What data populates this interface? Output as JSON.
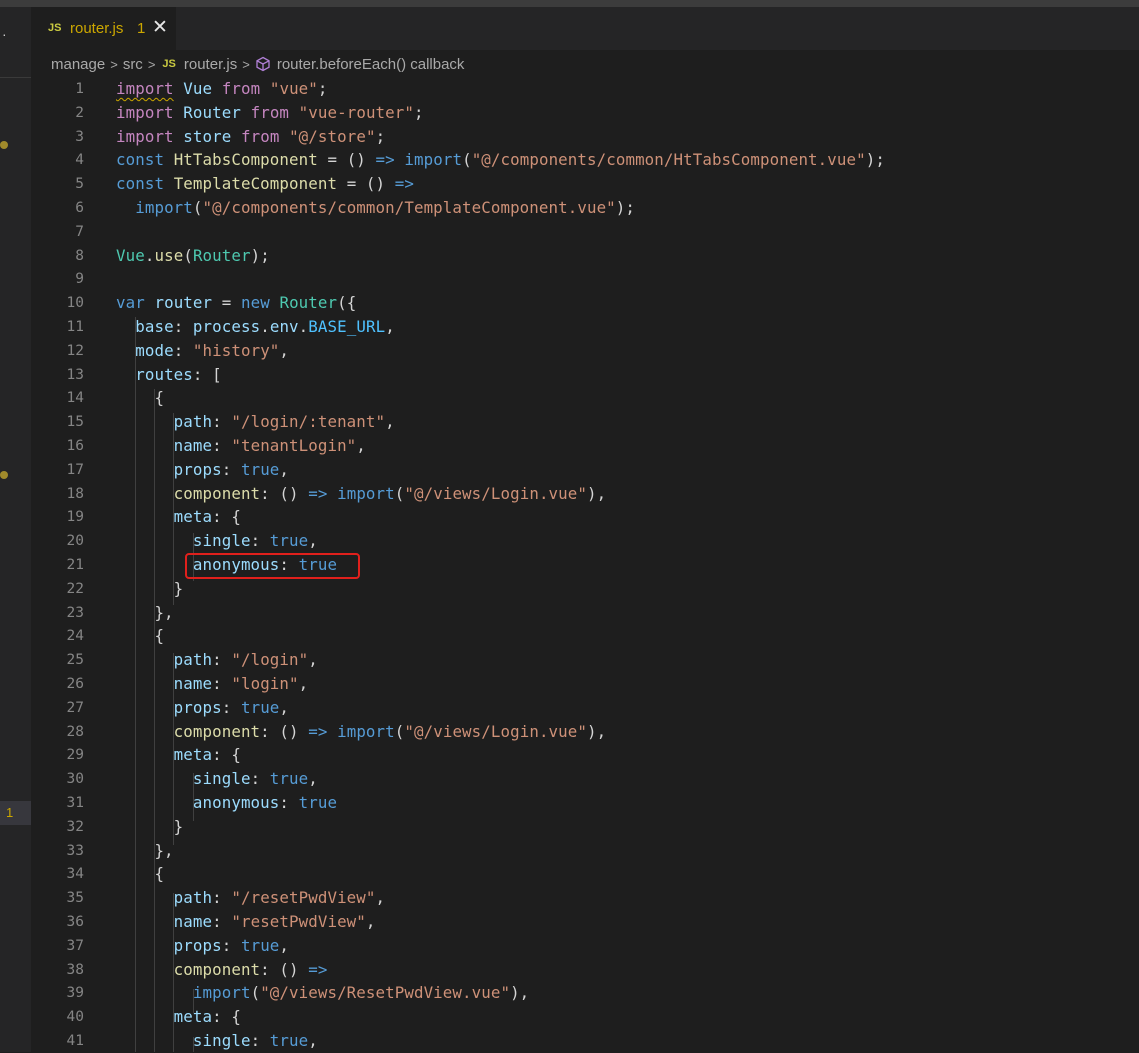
{
  "tab": {
    "js_badge": "JS",
    "filename": "router.js",
    "problem_count": "1",
    "close_glyph": "✕"
  },
  "breadcrumb": {
    "items": [
      "manage",
      "src",
      "router.js",
      "router.beforeEach() callback"
    ],
    "js_badge": "JS"
  },
  "sidebar": {
    "active_count": "1"
  },
  "lines": [
    {
      "n": "1",
      "t": [
        [
          "import",
          "kw2 squig"
        ],
        [
          " ",
          ""
        ],
        [
          "Vue",
          "var"
        ],
        [
          " ",
          ""
        ],
        [
          "from",
          "kw2"
        ],
        [
          " ",
          ""
        ],
        [
          "\"vue\"",
          "str"
        ],
        [
          ";",
          ""
        ]
      ]
    },
    {
      "n": "2",
      "t": [
        [
          "import",
          "kw2"
        ],
        [
          " ",
          ""
        ],
        [
          "Router",
          "var"
        ],
        [
          " ",
          ""
        ],
        [
          "from",
          "kw2"
        ],
        [
          " ",
          ""
        ],
        [
          "\"vue-router\"",
          "str"
        ],
        [
          ";",
          ""
        ]
      ]
    },
    {
      "n": "3",
      "t": [
        [
          "import",
          "kw2"
        ],
        [
          " ",
          ""
        ],
        [
          "store",
          "var"
        ],
        [
          " ",
          ""
        ],
        [
          "from",
          "kw2"
        ],
        [
          " ",
          ""
        ],
        [
          "\"@/store\"",
          "str"
        ],
        [
          ";",
          ""
        ]
      ]
    },
    {
      "n": "4",
      "t": [
        [
          "const",
          "kw"
        ],
        [
          " ",
          ""
        ],
        [
          "HtTabsComponent",
          "fn"
        ],
        [
          " = () ",
          ""
        ],
        [
          "=>",
          "kw"
        ],
        [
          " ",
          ""
        ],
        [
          "import",
          "kw"
        ],
        [
          "(",
          ""
        ],
        [
          "\"@/components/common/HtTabsComponent.vue\"",
          "str"
        ],
        [
          ");",
          ""
        ]
      ]
    },
    {
      "n": "5",
      "t": [
        [
          "const",
          "kw"
        ],
        [
          " ",
          ""
        ],
        [
          "TemplateComponent",
          "fn"
        ],
        [
          " = () ",
          ""
        ],
        [
          "=>",
          "kw"
        ]
      ]
    },
    {
      "n": "6",
      "t": [
        [
          "  ",
          ""
        ],
        [
          "import",
          "kw"
        ],
        [
          "(",
          ""
        ],
        [
          "\"@/components/common/TemplateComponent.vue\"",
          "str"
        ],
        [
          ");",
          ""
        ]
      ]
    },
    {
      "n": "7",
      "t": []
    },
    {
      "n": "8",
      "t": [
        [
          "Vue",
          "cls"
        ],
        [
          ".",
          ""
        ],
        [
          "use",
          "fn"
        ],
        [
          "(",
          ""
        ],
        [
          "Router",
          "cls"
        ],
        [
          ");",
          ""
        ]
      ]
    },
    {
      "n": "9",
      "t": []
    },
    {
      "n": "10",
      "t": [
        [
          "var",
          "kw"
        ],
        [
          " ",
          ""
        ],
        [
          "router",
          "var"
        ],
        [
          " = ",
          ""
        ],
        [
          "new",
          "kw"
        ],
        [
          " ",
          ""
        ],
        [
          "Router",
          "cls"
        ],
        [
          "({",
          ""
        ]
      ]
    },
    {
      "n": "11",
      "t": [
        [
          "  ",
          ""
        ],
        [
          "base",
          "var"
        ],
        [
          ": ",
          ""
        ],
        [
          "process",
          "var"
        ],
        [
          ".",
          ""
        ],
        [
          "env",
          "var"
        ],
        [
          ".",
          ""
        ],
        [
          "BASE_URL",
          "cst"
        ],
        [
          ",",
          ""
        ]
      ]
    },
    {
      "n": "12",
      "t": [
        [
          "  ",
          ""
        ],
        [
          "mode",
          "var"
        ],
        [
          ": ",
          ""
        ],
        [
          "\"history\"",
          "str"
        ],
        [
          ",",
          ""
        ]
      ]
    },
    {
      "n": "13",
      "t": [
        [
          "  ",
          ""
        ],
        [
          "routes",
          "var"
        ],
        [
          ": [",
          ""
        ]
      ]
    },
    {
      "n": "14",
      "t": [
        [
          "    {",
          ""
        ]
      ]
    },
    {
      "n": "15",
      "t": [
        [
          "      ",
          ""
        ],
        [
          "path",
          "var"
        ],
        [
          ": ",
          ""
        ],
        [
          "\"/login/:tenant\"",
          "str"
        ],
        [
          ",",
          ""
        ]
      ]
    },
    {
      "n": "16",
      "t": [
        [
          "      ",
          ""
        ],
        [
          "name",
          "var"
        ],
        [
          ": ",
          ""
        ],
        [
          "\"tenantLogin\"",
          "str"
        ],
        [
          ",",
          ""
        ]
      ]
    },
    {
      "n": "17",
      "t": [
        [
          "      ",
          ""
        ],
        [
          "props",
          "var"
        ],
        [
          ": ",
          ""
        ],
        [
          "true",
          "kw"
        ],
        [
          ",",
          ""
        ]
      ]
    },
    {
      "n": "18",
      "t": [
        [
          "      ",
          ""
        ],
        [
          "component",
          "fn"
        ],
        [
          ": () ",
          ""
        ],
        [
          "=>",
          "kw"
        ],
        [
          " ",
          ""
        ],
        [
          "import",
          "kw"
        ],
        [
          "(",
          ""
        ],
        [
          "\"@/views/Login.vue\"",
          "str"
        ],
        [
          "),",
          ""
        ]
      ]
    },
    {
      "n": "19",
      "t": [
        [
          "      ",
          ""
        ],
        [
          "meta",
          "var"
        ],
        [
          ": {",
          ""
        ]
      ]
    },
    {
      "n": "20",
      "t": [
        [
          "        ",
          ""
        ],
        [
          "single",
          "var"
        ],
        [
          ": ",
          ""
        ],
        [
          "true",
          "kw"
        ],
        [
          ",",
          ""
        ]
      ]
    },
    {
      "n": "21",
      "t": [
        [
          "        ",
          ""
        ],
        [
          "anonymous",
          "var"
        ],
        [
          ": ",
          ""
        ],
        [
          "true",
          "kw"
        ]
      ]
    },
    {
      "n": "22",
      "t": [
        [
          "      }",
          ""
        ]
      ]
    },
    {
      "n": "23",
      "t": [
        [
          "    },",
          ""
        ]
      ]
    },
    {
      "n": "24",
      "t": [
        [
          "    {",
          ""
        ]
      ]
    },
    {
      "n": "25",
      "t": [
        [
          "      ",
          ""
        ],
        [
          "path",
          "var"
        ],
        [
          ": ",
          ""
        ],
        [
          "\"/login\"",
          "str"
        ],
        [
          ",",
          ""
        ]
      ]
    },
    {
      "n": "26",
      "t": [
        [
          "      ",
          ""
        ],
        [
          "name",
          "var"
        ],
        [
          ": ",
          ""
        ],
        [
          "\"login\"",
          "str"
        ],
        [
          ",",
          ""
        ]
      ]
    },
    {
      "n": "27",
      "t": [
        [
          "      ",
          ""
        ],
        [
          "props",
          "var"
        ],
        [
          ": ",
          ""
        ],
        [
          "true",
          "kw"
        ],
        [
          ",",
          ""
        ]
      ]
    },
    {
      "n": "28",
      "t": [
        [
          "      ",
          ""
        ],
        [
          "component",
          "fn"
        ],
        [
          ": () ",
          ""
        ],
        [
          "=>",
          "kw"
        ],
        [
          " ",
          ""
        ],
        [
          "import",
          "kw"
        ],
        [
          "(",
          ""
        ],
        [
          "\"@/views/Login.vue\"",
          "str"
        ],
        [
          "),",
          ""
        ]
      ]
    },
    {
      "n": "29",
      "t": [
        [
          "      ",
          ""
        ],
        [
          "meta",
          "var"
        ],
        [
          ": {",
          ""
        ]
      ]
    },
    {
      "n": "30",
      "t": [
        [
          "        ",
          ""
        ],
        [
          "single",
          "var"
        ],
        [
          ": ",
          ""
        ],
        [
          "true",
          "kw"
        ],
        [
          ",",
          ""
        ]
      ]
    },
    {
      "n": "31",
      "t": [
        [
          "        ",
          ""
        ],
        [
          "anonymous",
          "var"
        ],
        [
          ": ",
          ""
        ],
        [
          "true",
          "kw"
        ]
      ]
    },
    {
      "n": "32",
      "t": [
        [
          "      }",
          ""
        ]
      ]
    },
    {
      "n": "33",
      "t": [
        [
          "    },",
          ""
        ]
      ]
    },
    {
      "n": "34",
      "t": [
        [
          "    {",
          ""
        ]
      ]
    },
    {
      "n": "35",
      "t": [
        [
          "      ",
          ""
        ],
        [
          "path",
          "var"
        ],
        [
          ": ",
          ""
        ],
        [
          "\"/resetPwdView\"",
          "str"
        ],
        [
          ",",
          ""
        ]
      ]
    },
    {
      "n": "36",
      "t": [
        [
          "      ",
          ""
        ],
        [
          "name",
          "var"
        ],
        [
          ": ",
          ""
        ],
        [
          "\"resetPwdView\"",
          "str"
        ],
        [
          ",",
          ""
        ]
      ]
    },
    {
      "n": "37",
      "t": [
        [
          "      ",
          ""
        ],
        [
          "props",
          "var"
        ],
        [
          ": ",
          ""
        ],
        [
          "true",
          "kw"
        ],
        [
          ",",
          ""
        ]
      ]
    },
    {
      "n": "38",
      "t": [
        [
          "      ",
          ""
        ],
        [
          "component",
          "fn"
        ],
        [
          ": () ",
          ""
        ],
        [
          "=>",
          "kw"
        ]
      ]
    },
    {
      "n": "39",
      "t": [
        [
          "        ",
          ""
        ],
        [
          "import",
          "kw"
        ],
        [
          "(",
          ""
        ],
        [
          "\"@/views/ResetPwdView.vue\"",
          "str"
        ],
        [
          "),",
          ""
        ]
      ]
    },
    {
      "n": "40",
      "t": [
        [
          "      ",
          ""
        ],
        [
          "meta",
          "var"
        ],
        [
          ": {",
          ""
        ]
      ]
    },
    {
      "n": "41",
      "t": [
        [
          "        ",
          ""
        ],
        [
          "single",
          "var"
        ],
        [
          ": ",
          ""
        ],
        [
          "true",
          "kw"
        ],
        [
          ",",
          ""
        ]
      ]
    }
  ]
}
